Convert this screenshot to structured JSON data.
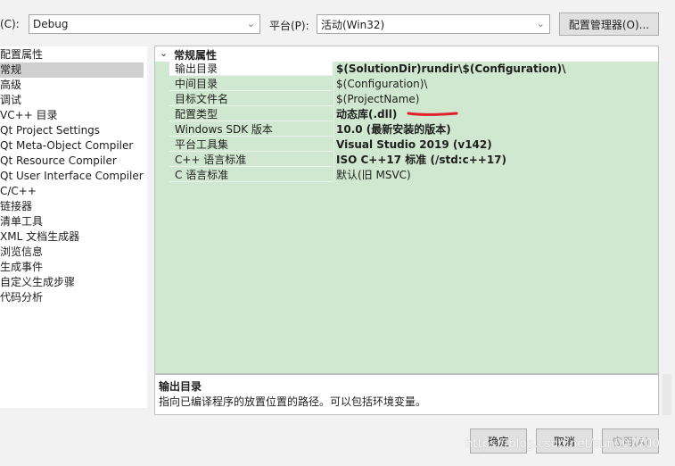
{
  "toolbar": {
    "config_label": "(C):",
    "config_value": "Debug",
    "platform_label": "平台(P):",
    "platform_value": "活动(Win32)",
    "config_manager_button": "配置管理器(O)..."
  },
  "tree": {
    "items": [
      "配置属性",
      "常规",
      "高级",
      "调试",
      "VC++ 目录",
      "Qt Project Settings",
      "Qt Meta-Object Compiler",
      "Qt Resource Compiler",
      "Qt User Interface Compiler",
      "C/C++",
      "链接器",
      "清单工具",
      "XML 文档生成器",
      "浏览信息",
      "生成事件",
      "自定义生成步骤",
      "代码分析"
    ],
    "selected_index": 1
  },
  "grid": {
    "section_title": "常规属性",
    "rows": [
      {
        "name": "输出目录",
        "value": "$(SolutionDir)rundir\\$(Configuration)\\"
      },
      {
        "name": "中间目录",
        "value": "$(Configuration)\\"
      },
      {
        "name": "目标文件名",
        "value": "$(ProjectName)"
      },
      {
        "name": "配置类型",
        "value": "动态库(.dll)"
      },
      {
        "name": "Windows SDK 版本",
        "value": "10.0 (最新安装的版本)"
      },
      {
        "name": "平台工具集",
        "value": "Visual Studio 2019 (v142)"
      },
      {
        "name": "C++ 语言标准",
        "value": "ISO C++17 标准 (/std:c++17)"
      },
      {
        "name": "C 语言标准",
        "value": "默认(旧 MSVC)"
      }
    ]
  },
  "description": {
    "title": "输出目录",
    "text": "指向已编译程序的放置位置的路径。可以包括环境变量。"
  },
  "buttons": {
    "ok": "确定",
    "cancel": "取消",
    "apply": "应用(A)"
  },
  "watermark": "https://blog.csdn.net/sun007700",
  "colors": {
    "grid_bg": "#cfe8cf",
    "annotation": "#e0202a"
  }
}
